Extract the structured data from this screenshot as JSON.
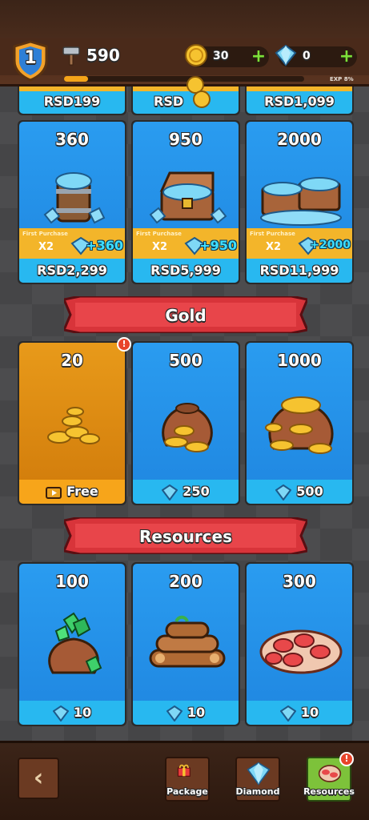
{
  "header": {
    "level": "1",
    "power": "590",
    "xp_label": "EXP 8%",
    "xp_progress": 0.08,
    "gold_amount": "30",
    "gem_amount": "0",
    "plus_symbol": "+"
  },
  "diamond_section": {
    "top_row_prices": [
      "RSD199",
      "RSD",
      "RSD1,099"
    ],
    "packs": [
      {
        "amount": "360",
        "first_purchase": "First Purchase",
        "multiplier": "X2",
        "bonus": "+360",
        "price": "RSD2,299"
      },
      {
        "amount": "950",
        "first_purchase": "First Purchase",
        "multiplier": "X2",
        "bonus": "+950",
        "price": "RSD5,999"
      },
      {
        "amount": "2000",
        "first_purchase": "First Purchase",
        "multiplier": "X2",
        "bonus": "+2000",
        "price": "RSD11,999"
      }
    ]
  },
  "gold_section": {
    "title": "Gold",
    "packs": [
      {
        "amount": "20",
        "cost": "Free",
        "badge": "!"
      },
      {
        "amount": "500",
        "cost": "250"
      },
      {
        "amount": "1000",
        "cost": "500"
      }
    ]
  },
  "resources_section": {
    "title": "Resources",
    "packs": [
      {
        "amount": "100",
        "cost": "10",
        "icon": "emerald-bag-icon"
      },
      {
        "amount": "200",
        "cost": "10",
        "icon": "wood-logs-icon"
      },
      {
        "amount": "300",
        "cost": "10",
        "icon": "meat-pile-icon"
      }
    ]
  },
  "bottom_nav": {
    "back_symbol": "‹",
    "tabs": [
      {
        "label": "Package",
        "icon": "gift-box-icon"
      },
      {
        "label": "Diamond",
        "icon": "diamond-icon"
      },
      {
        "label": "Resources",
        "icon": "meat-icon",
        "badge": "!"
      }
    ]
  },
  "colors": {
    "card_blue": "#2a9cf0",
    "footer_blue": "#28b8f0",
    "gold_card": "#e89a1a",
    "banner_red": "#d8343a",
    "accent_green": "#7dc23a"
  }
}
